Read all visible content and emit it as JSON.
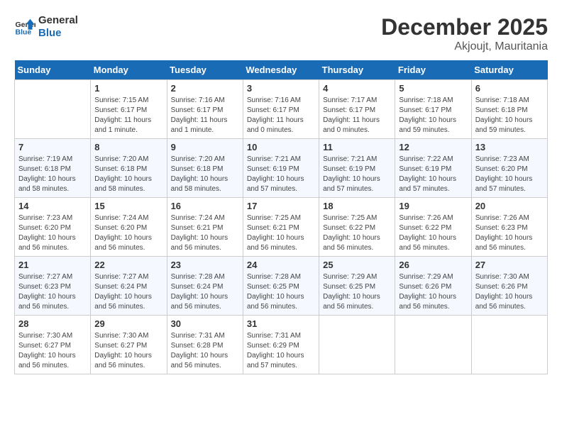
{
  "header": {
    "logo_line1": "General",
    "logo_line2": "Blue",
    "month": "December 2025",
    "location": "Akjoujt, Mauritania"
  },
  "weekdays": [
    "Sunday",
    "Monday",
    "Tuesday",
    "Wednesday",
    "Thursday",
    "Friday",
    "Saturday"
  ],
  "weeks": [
    [
      {
        "day": "",
        "sunrise": "",
        "sunset": "",
        "daylight": ""
      },
      {
        "day": "1",
        "sunrise": "Sunrise: 7:15 AM",
        "sunset": "Sunset: 6:17 PM",
        "daylight": "Daylight: 11 hours and 1 minute."
      },
      {
        "day": "2",
        "sunrise": "Sunrise: 7:16 AM",
        "sunset": "Sunset: 6:17 PM",
        "daylight": "Daylight: 11 hours and 1 minute."
      },
      {
        "day": "3",
        "sunrise": "Sunrise: 7:16 AM",
        "sunset": "Sunset: 6:17 PM",
        "daylight": "Daylight: 11 hours and 0 minutes."
      },
      {
        "day": "4",
        "sunrise": "Sunrise: 7:17 AM",
        "sunset": "Sunset: 6:17 PM",
        "daylight": "Daylight: 11 hours and 0 minutes."
      },
      {
        "day": "5",
        "sunrise": "Sunrise: 7:18 AM",
        "sunset": "Sunset: 6:17 PM",
        "daylight": "Daylight: 10 hours and 59 minutes."
      },
      {
        "day": "6",
        "sunrise": "Sunrise: 7:18 AM",
        "sunset": "Sunset: 6:18 PM",
        "daylight": "Daylight: 10 hours and 59 minutes."
      }
    ],
    [
      {
        "day": "7",
        "sunrise": "Sunrise: 7:19 AM",
        "sunset": "Sunset: 6:18 PM",
        "daylight": "Daylight: 10 hours and 58 minutes."
      },
      {
        "day": "8",
        "sunrise": "Sunrise: 7:20 AM",
        "sunset": "Sunset: 6:18 PM",
        "daylight": "Daylight: 10 hours and 58 minutes."
      },
      {
        "day": "9",
        "sunrise": "Sunrise: 7:20 AM",
        "sunset": "Sunset: 6:18 PM",
        "daylight": "Daylight: 10 hours and 58 minutes."
      },
      {
        "day": "10",
        "sunrise": "Sunrise: 7:21 AM",
        "sunset": "Sunset: 6:19 PM",
        "daylight": "Daylight: 10 hours and 57 minutes."
      },
      {
        "day": "11",
        "sunrise": "Sunrise: 7:21 AM",
        "sunset": "Sunset: 6:19 PM",
        "daylight": "Daylight: 10 hours and 57 minutes."
      },
      {
        "day": "12",
        "sunrise": "Sunrise: 7:22 AM",
        "sunset": "Sunset: 6:19 PM",
        "daylight": "Daylight: 10 hours and 57 minutes."
      },
      {
        "day": "13",
        "sunrise": "Sunrise: 7:23 AM",
        "sunset": "Sunset: 6:20 PM",
        "daylight": "Daylight: 10 hours and 57 minutes."
      }
    ],
    [
      {
        "day": "14",
        "sunrise": "Sunrise: 7:23 AM",
        "sunset": "Sunset: 6:20 PM",
        "daylight": "Daylight: 10 hours and 56 minutes."
      },
      {
        "day": "15",
        "sunrise": "Sunrise: 7:24 AM",
        "sunset": "Sunset: 6:20 PM",
        "daylight": "Daylight: 10 hours and 56 minutes."
      },
      {
        "day": "16",
        "sunrise": "Sunrise: 7:24 AM",
        "sunset": "Sunset: 6:21 PM",
        "daylight": "Daylight: 10 hours and 56 minutes."
      },
      {
        "day": "17",
        "sunrise": "Sunrise: 7:25 AM",
        "sunset": "Sunset: 6:21 PM",
        "daylight": "Daylight: 10 hours and 56 minutes."
      },
      {
        "day": "18",
        "sunrise": "Sunrise: 7:25 AM",
        "sunset": "Sunset: 6:22 PM",
        "daylight": "Daylight: 10 hours and 56 minutes."
      },
      {
        "day": "19",
        "sunrise": "Sunrise: 7:26 AM",
        "sunset": "Sunset: 6:22 PM",
        "daylight": "Daylight: 10 hours and 56 minutes."
      },
      {
        "day": "20",
        "sunrise": "Sunrise: 7:26 AM",
        "sunset": "Sunset: 6:23 PM",
        "daylight": "Daylight: 10 hours and 56 minutes."
      }
    ],
    [
      {
        "day": "21",
        "sunrise": "Sunrise: 7:27 AM",
        "sunset": "Sunset: 6:23 PM",
        "daylight": "Daylight: 10 hours and 56 minutes."
      },
      {
        "day": "22",
        "sunrise": "Sunrise: 7:27 AM",
        "sunset": "Sunset: 6:24 PM",
        "daylight": "Daylight: 10 hours and 56 minutes."
      },
      {
        "day": "23",
        "sunrise": "Sunrise: 7:28 AM",
        "sunset": "Sunset: 6:24 PM",
        "daylight": "Daylight: 10 hours and 56 minutes."
      },
      {
        "day": "24",
        "sunrise": "Sunrise: 7:28 AM",
        "sunset": "Sunset: 6:25 PM",
        "daylight": "Daylight: 10 hours and 56 minutes."
      },
      {
        "day": "25",
        "sunrise": "Sunrise: 7:29 AM",
        "sunset": "Sunset: 6:25 PM",
        "daylight": "Daylight: 10 hours and 56 minutes."
      },
      {
        "day": "26",
        "sunrise": "Sunrise: 7:29 AM",
        "sunset": "Sunset: 6:26 PM",
        "daylight": "Daylight: 10 hours and 56 minutes."
      },
      {
        "day": "27",
        "sunrise": "Sunrise: 7:30 AM",
        "sunset": "Sunset: 6:26 PM",
        "daylight": "Daylight: 10 hours and 56 minutes."
      }
    ],
    [
      {
        "day": "28",
        "sunrise": "Sunrise: 7:30 AM",
        "sunset": "Sunset: 6:27 PM",
        "daylight": "Daylight: 10 hours and 56 minutes."
      },
      {
        "day": "29",
        "sunrise": "Sunrise: 7:30 AM",
        "sunset": "Sunset: 6:27 PM",
        "daylight": "Daylight: 10 hours and 56 minutes."
      },
      {
        "day": "30",
        "sunrise": "Sunrise: 7:31 AM",
        "sunset": "Sunset: 6:28 PM",
        "daylight": "Daylight: 10 hours and 56 minutes."
      },
      {
        "day": "31",
        "sunrise": "Sunrise: 7:31 AM",
        "sunset": "Sunset: 6:29 PM",
        "daylight": "Daylight: 10 hours and 57 minutes."
      },
      {
        "day": "",
        "sunrise": "",
        "sunset": "",
        "daylight": ""
      },
      {
        "day": "",
        "sunrise": "",
        "sunset": "",
        "daylight": ""
      },
      {
        "day": "",
        "sunrise": "",
        "sunset": "",
        "daylight": ""
      }
    ]
  ]
}
